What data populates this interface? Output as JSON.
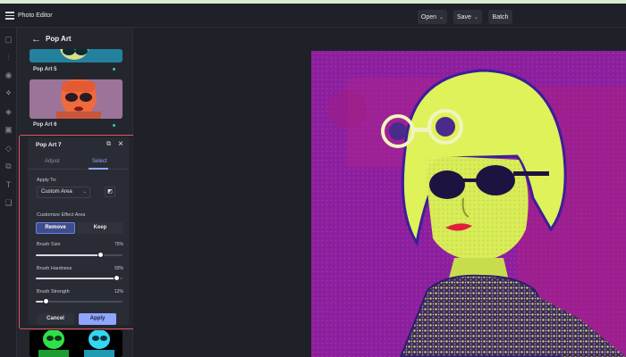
{
  "app": {
    "title": "Photo Editor"
  },
  "toolbar": {
    "open_label": "Open",
    "save_label": "Save",
    "batch_label": "Batch"
  },
  "icons": {
    "menu": "hamburger-icon",
    "sidebar": [
      "image-icon",
      "adjust-icon",
      "eye-icon",
      "effects-icon",
      "sticker-icon",
      "frames-icon",
      "shapes-icon",
      "crop-icon",
      "text-icon",
      "layers-icon"
    ]
  },
  "panel": {
    "title": "Pop Art",
    "presets": [
      {
        "label": "Pop Art 5",
        "active": true
      },
      {
        "label": "Pop Art 6",
        "active": true
      }
    ]
  },
  "popup": {
    "title": "Pop Art 7",
    "tabs": [
      {
        "label": "Adjust"
      },
      {
        "label": "Select"
      }
    ],
    "active_tab": "Select",
    "apply_to_label": "Apply To:",
    "apply_to_value": "Custom Area",
    "customize_label": "Customize Effect Area",
    "mode_remove": "Remove",
    "mode_keep": "Keep",
    "active_mode": "Remove",
    "brush_size": {
      "label": "Brush Size",
      "value_text": "75%",
      "value": 0.75
    },
    "brush_hardness": {
      "label": "Brush Hardness",
      "value_text": "93%",
      "value": 0.93
    },
    "brush_strength": {
      "label": "Brush Strength",
      "value_text": "12%",
      "value": 0.12
    },
    "cancel_label": "Cancel",
    "apply_label": "Apply"
  },
  "colors": {
    "accent": "#8ea6ff",
    "highlight_border": "#e0505f",
    "active_dot": "#2bd4a7",
    "artwork_background": "#8a1fa0",
    "artwork_face": "#dff25a"
  }
}
